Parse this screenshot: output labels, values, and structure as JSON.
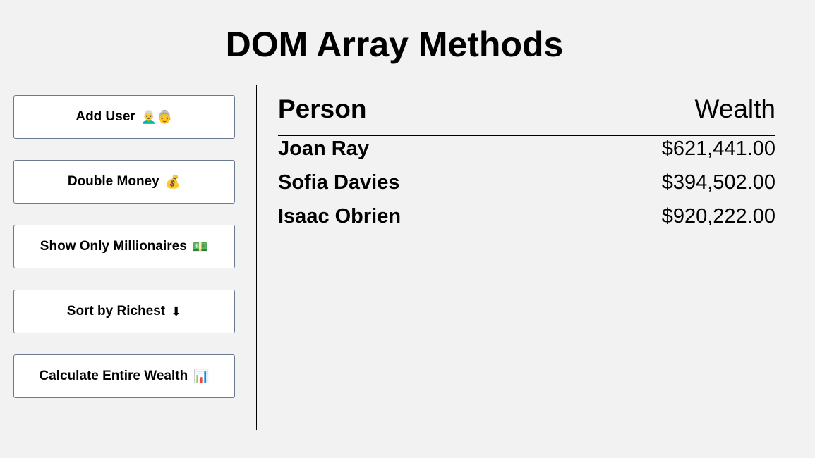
{
  "page": {
    "title": "DOM Array Methods"
  },
  "actions": [
    {
      "label": "Add User",
      "icon": "👨‍🦳👵",
      "icon_name": "people-icon"
    },
    {
      "label": "Double Money",
      "icon": "💰",
      "icon_name": "money-bag-icon"
    },
    {
      "label": "Show Only Millionaires",
      "icon": "💵",
      "icon_name": "banknote-icon"
    },
    {
      "label": "Sort by Richest",
      "icon": "⬇",
      "icon_name": "down-arrow-icon"
    },
    {
      "label": "Calculate Entire Wealth",
      "icon": "📊",
      "icon_name": "bar-chart-icon"
    }
  ],
  "table": {
    "headers": {
      "person": "Person",
      "wealth": "Wealth"
    },
    "rows": [
      {
        "name": "Joan Ray",
        "wealth": "$621,441.00"
      },
      {
        "name": "Sofia Davies",
        "wealth": "$394,502.00"
      },
      {
        "name": "Isaac Obrien",
        "wealth": "$920,222.00"
      }
    ]
  }
}
